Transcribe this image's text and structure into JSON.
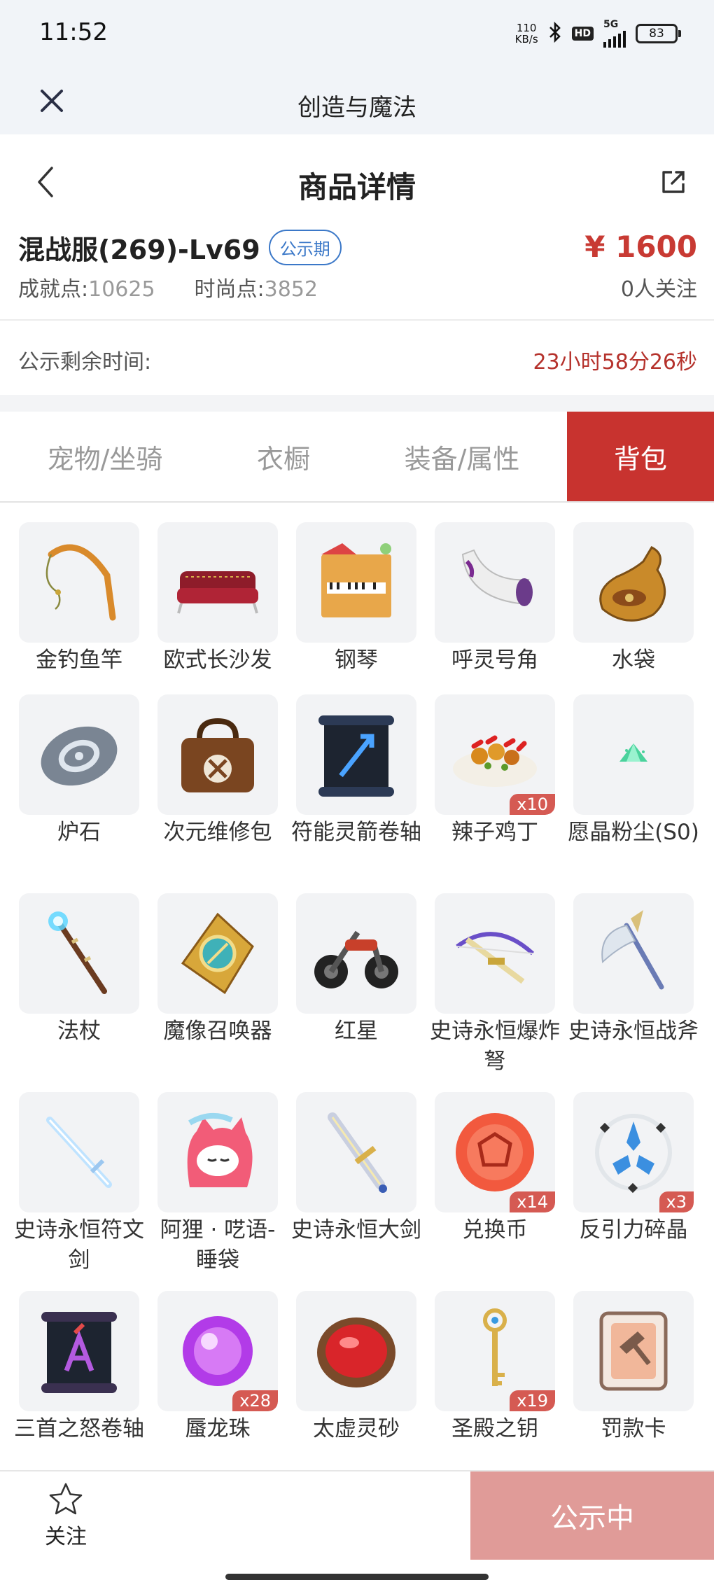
{
  "status_bar": {
    "time": "11:52",
    "net_speed_value": "110",
    "net_speed_unit": "KB/s",
    "hd": "HD",
    "network": "5G",
    "battery": "83"
  },
  "app_bar": {
    "title": "创造与魔法"
  },
  "header": {
    "title": "商品详情"
  },
  "product": {
    "server": "混战服(269)-Lv69",
    "badge": "公示期",
    "price": "¥ 1600",
    "achievement_label": "成就点:",
    "achievement_value": "10625",
    "fashion_label": "时尚点:",
    "fashion_value": "3852",
    "followers": "0人关注"
  },
  "countdown": {
    "label": "公示剩余时间:",
    "value": "23小时58分26秒"
  },
  "tabs": [
    {
      "label": "宠物/坐骑",
      "active": false
    },
    {
      "label": "衣橱",
      "active": false
    },
    {
      "label": "装备/属性",
      "active": false
    },
    {
      "label": "背包",
      "active": true
    }
  ],
  "items": [
    {
      "name": "金钓鱼竿",
      "icon": "fishing-rod-icon",
      "qty": ""
    },
    {
      "name": "欧式长沙发",
      "icon": "sofa-icon",
      "qty": ""
    },
    {
      "name": "钢琴",
      "icon": "piano-icon",
      "qty": ""
    },
    {
      "name": "呼灵号角",
      "icon": "horn-icon",
      "qty": ""
    },
    {
      "name": "水袋",
      "icon": "waterskin-icon",
      "qty": ""
    },
    {
      "name": "炉石",
      "icon": "hearthstone-icon",
      "qty": ""
    },
    {
      "name": "次元维修包",
      "icon": "repair-bag-icon",
      "qty": ""
    },
    {
      "name": "符能灵箭卷轴",
      "icon": "scroll-blue-icon",
      "qty": ""
    },
    {
      "name": "辣子鸡丁",
      "icon": "spicy-chicken-icon",
      "qty": "x10"
    },
    {
      "name": "愿晶粉尘(S0)",
      "icon": "crystal-dust-icon",
      "qty": ""
    },
    {
      "name": "法杖",
      "icon": "staff-icon",
      "qty": ""
    },
    {
      "name": "魔像召唤器",
      "icon": "golem-summoner-icon",
      "qty": ""
    },
    {
      "name": "红星",
      "icon": "motorcycle-icon",
      "qty": ""
    },
    {
      "name": "史诗永恒爆炸弩",
      "icon": "crossbow-icon",
      "qty": ""
    },
    {
      "name": "史诗永恒战斧",
      "icon": "battle-axe-icon",
      "qty": ""
    },
    {
      "name": "史诗永恒符文剑",
      "icon": "rune-sword-icon",
      "qty": ""
    },
    {
      "name": "阿狸 · 呓语-睡袋",
      "icon": "ali-sleeping-bag-icon",
      "qty": ""
    },
    {
      "name": "史诗永恒大剑",
      "icon": "greatsword-icon",
      "qty": ""
    },
    {
      "name": "兑换币",
      "icon": "exchange-coin-icon",
      "qty": "x14"
    },
    {
      "name": "反引力碎晶",
      "icon": "antigravity-shard-icon",
      "qty": "x3"
    },
    {
      "name": "三首之怒卷轴",
      "icon": "scroll-purple-icon",
      "qty": ""
    },
    {
      "name": "蜃龙珠",
      "icon": "dragon-pearl-icon",
      "qty": "x28"
    },
    {
      "name": "太虚灵砂",
      "icon": "spirit-sand-icon",
      "qty": ""
    },
    {
      "name": "圣殿之钥",
      "icon": "temple-key-icon",
      "qty": "x19"
    },
    {
      "name": "罚款卡",
      "icon": "fine-card-icon",
      "qty": ""
    }
  ],
  "bottom_bar": {
    "follow_label": "关注",
    "cta_label": "公示中"
  },
  "colors": {
    "accent": "#c8332f",
    "price": "#c83a33",
    "countdown": "#b5322c",
    "badge": "#3b78c8",
    "cta_disabled": "#e09b98"
  }
}
